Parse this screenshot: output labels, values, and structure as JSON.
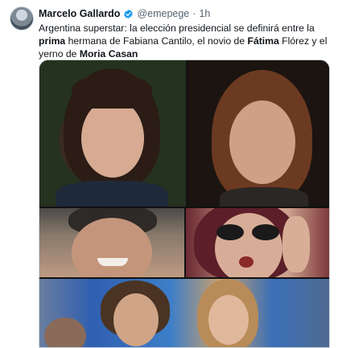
{
  "author": {
    "name": "Marcelo Gallardo",
    "handle": "@emepege",
    "separator": "·",
    "time": "1h",
    "verified_color": "#1d9bf0"
  },
  "tweet": {
    "segments": [
      {
        "text": "Argentina superstar: la elección presidencial se definirá entre la ",
        "bold": false
      },
      {
        "text": "prima",
        "bold": true
      },
      {
        "text": " hermana de Fabiana Cantilo, el novio de ",
        "bold": false
      },
      {
        "text": "Fátima",
        "bold": true
      },
      {
        "text": " Flórez y el yerno de ",
        "bold": false
      },
      {
        "text": "Moria",
        "bold": true
      },
      {
        "text": " ",
        "bold": false
      },
      {
        "text": "Casan",
        "bold": true
      }
    ]
  },
  "media": {
    "photos": [
      {
        "name": "photo-woman-bangs"
      },
      {
        "name": "photo-woman-brown-hair"
      },
      {
        "name": "photo-man-smiling"
      },
      {
        "name": "photo-woman-sunglasses"
      },
      {
        "name": "photo-couple-tv-set"
      }
    ]
  }
}
